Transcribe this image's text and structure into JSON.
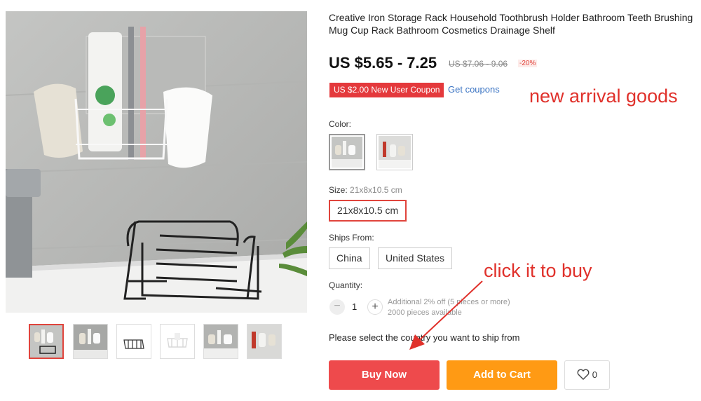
{
  "product": {
    "title": "Creative Iron Storage Rack Household Toothbrush Holder Bathroom Teeth Brushing Mug Cup Rack Bathroom Cosmetics Drainage Shelf",
    "price": "US $5.65 - 7.25",
    "old_price": "US $7.06 - 9.06",
    "discount": "-20%",
    "coupon_label": "US $2.00 New User Coupon",
    "get_coupons": "Get coupons"
  },
  "annotations": {
    "new_arrival": "new arrival goods",
    "click_to_buy": "click it to buy"
  },
  "options": {
    "color_label": "Color:",
    "size_label": "Size:",
    "size_selected_hint": "21x8x10.5 cm",
    "sizes": [
      "21x8x10.5 cm"
    ],
    "ships_from_label": "Ships From:",
    "ships_from": [
      "China",
      "United States"
    ],
    "quantity_label": "Quantity:",
    "quantity_value": "1",
    "quantity_note_1": "Additional 2% off (5 pieces or more)",
    "quantity_note_2": "2000 pieces available",
    "ship_note": "Please select the country you want to ship from"
  },
  "actions": {
    "buy_now": "Buy Now",
    "add_to_cart": "Add to Cart",
    "wishlist_count": "0"
  },
  "colors": {
    "accent_red": "#ee4a4c",
    "cart_orange": "#ff9a14",
    "link_blue": "#3b74c3"
  }
}
